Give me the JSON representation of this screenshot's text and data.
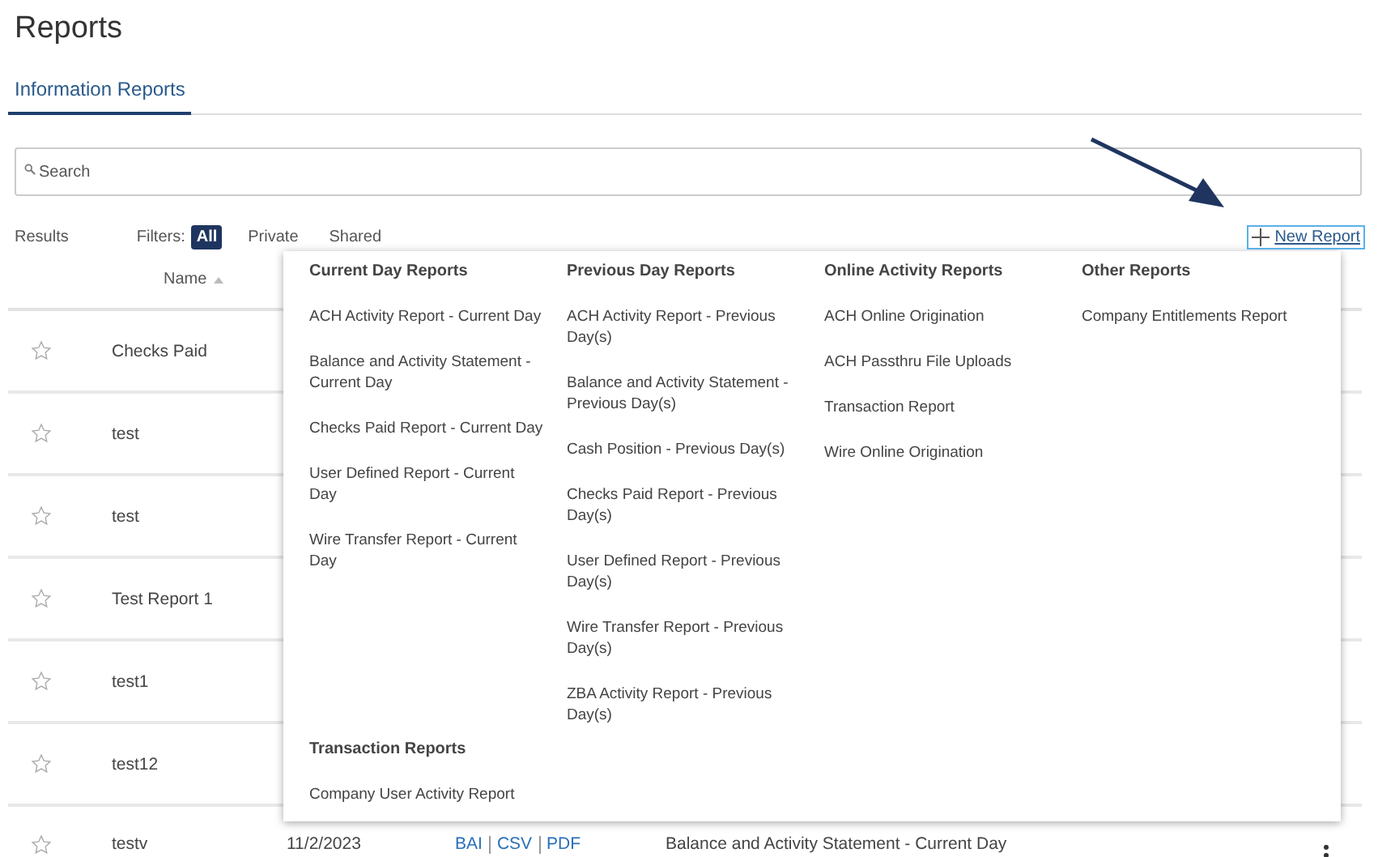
{
  "title": "Reports",
  "tabs": [
    {
      "label": "Information Reports",
      "selected": true
    }
  ],
  "search": {
    "placeholder": "Search"
  },
  "results_label": "Results",
  "filters_label": "Filters:",
  "filters": [
    {
      "label": "All",
      "selected": true
    },
    {
      "label": "Private",
      "selected": false
    },
    {
      "label": "Shared",
      "selected": false
    }
  ],
  "new_report": {
    "label": "New Report",
    "expanded": true
  },
  "table": {
    "columns": [
      {
        "label": "Name"
      }
    ],
    "rows": [
      {
        "name": "Checks Paid",
        "starred": false
      },
      {
        "name": "test",
        "starred": false
      },
      {
        "name": "test",
        "starred": false
      },
      {
        "name": "Test Report 1",
        "starred": false
      },
      {
        "name": "test1",
        "starred": false
      },
      {
        "name": "test12",
        "starred": false
      },
      {
        "name": "testv",
        "starred": false,
        "date": "11/2/2023",
        "formats": [
          "BAI",
          "CSV",
          "PDF"
        ],
        "report_type": "Balance and Activity Statement - Current Day"
      }
    ]
  },
  "menu": {
    "sections": [
      {
        "heading": "Current Day Reports",
        "items": [
          "ACH Activity Report - Current Day",
          "Balance and Activity Statement - Current Day",
          "Checks Paid Report - Current Day",
          "User Defined Report - Current Day",
          "Wire Transfer Report - Current Day"
        ]
      },
      {
        "heading": "Previous Day Reports",
        "items": [
          "ACH Activity Report - Previous Day(s)",
          "Balance and Activity Statement - Previous Day(s)",
          "Cash Position - Previous Day(s)",
          "Checks Paid Report - Previous Day(s)",
          "User Defined Report - Previous Day(s)",
          "Wire Transfer Report - Previous Day(s)",
          "ZBA Activity Report - Previous Day(s)"
        ]
      },
      {
        "heading": "Online Activity Reports",
        "items": [
          "ACH Online Origination",
          "ACH Passthru File Uploads",
          "Transaction Report",
          "Wire Online Origination"
        ]
      },
      {
        "heading": "Other Reports",
        "items": [
          "Company Entitlements Report"
        ]
      },
      {
        "heading": "Transaction Reports",
        "items": [
          "Company User Activity Report"
        ]
      }
    ]
  }
}
